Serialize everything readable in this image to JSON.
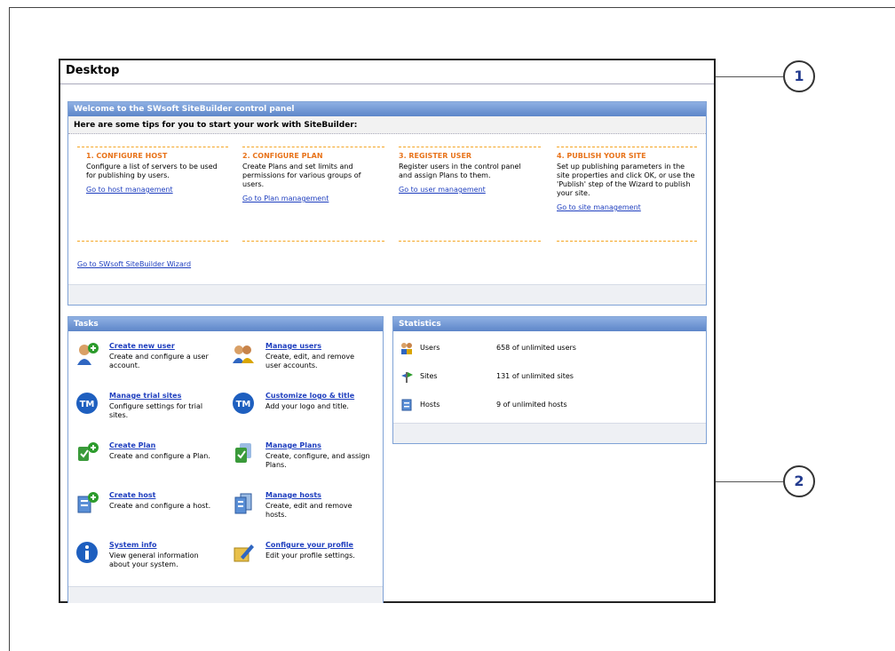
{
  "desktop": {
    "title": "Desktop"
  },
  "callouts": [
    "1",
    "2"
  ],
  "welcome": {
    "header": "Welcome to the SWsoft SiteBuilder control panel",
    "subheader": "Here are some tips for you to start your work with SiteBuilder:",
    "steps": [
      {
        "title": "1. CONFIGURE HOST",
        "text": "Configure a list of servers to be used for publishing by users.",
        "link": "Go to host management"
      },
      {
        "title": "2. CONFIGURE PLAN",
        "text": "Create Plans and set limits and permissions for various groups of users.",
        "link": "Go to Plan management"
      },
      {
        "title": "3. REGISTER USER",
        "text": "Register users in the control panel and assign Plans to them.",
        "link": "Go to user management"
      },
      {
        "title": "4. PUBLISH YOUR SITE",
        "text": "Set up publishing parameters in the site properties and click OK, or use the 'Publish' step of the Wizard to publish your site.",
        "link": "Go to site management"
      }
    ],
    "wizard_link": "Go to SWsoft SiteBuilder Wizard"
  },
  "tasks": {
    "header": "Tasks",
    "items": [
      {
        "title": "Create new user",
        "desc": "Create and configure a user account.",
        "icon": "user-add-icon"
      },
      {
        "title": "Manage users",
        "desc": "Create, edit, and remove user accounts.",
        "icon": "users-icon"
      },
      {
        "title": "Manage trial sites",
        "desc": "Configure settings for trial sites.",
        "icon": "tm-icon"
      },
      {
        "title": "Customize logo & title",
        "desc": "Add your logo and title.",
        "icon": "tm-icon"
      },
      {
        "title": "Create Plan",
        "desc": "Create and configure a Plan.",
        "icon": "plan-add-icon"
      },
      {
        "title": "Manage Plans",
        "desc": "Create, configure, and assign Plans.",
        "icon": "plans-icon"
      },
      {
        "title": "Create host",
        "desc": "Create and configure a host.",
        "icon": "host-add-icon"
      },
      {
        "title": "Manage hosts",
        "desc": "Create, edit and remove hosts.",
        "icon": "hosts-icon"
      },
      {
        "title": "System info",
        "desc": "View general information about your system.",
        "icon": "info-icon"
      },
      {
        "title": "Configure your profile",
        "desc": "Edit your profile settings.",
        "icon": "profile-edit-icon"
      }
    ]
  },
  "statistics": {
    "header": "Statistics",
    "rows": [
      {
        "label": "Users",
        "value": "658 of unlimited users",
        "icon": "users-icon"
      },
      {
        "label": "Sites",
        "value": "131 of unlimited sites",
        "icon": "sites-icon"
      },
      {
        "label": "Hosts",
        "value": "9 of unlimited hosts",
        "icon": "hosts-icon"
      }
    ]
  },
  "colors": {
    "accent": "#5d86c9",
    "step_title": "#e8731a",
    "link": "#1f3fbf"
  }
}
